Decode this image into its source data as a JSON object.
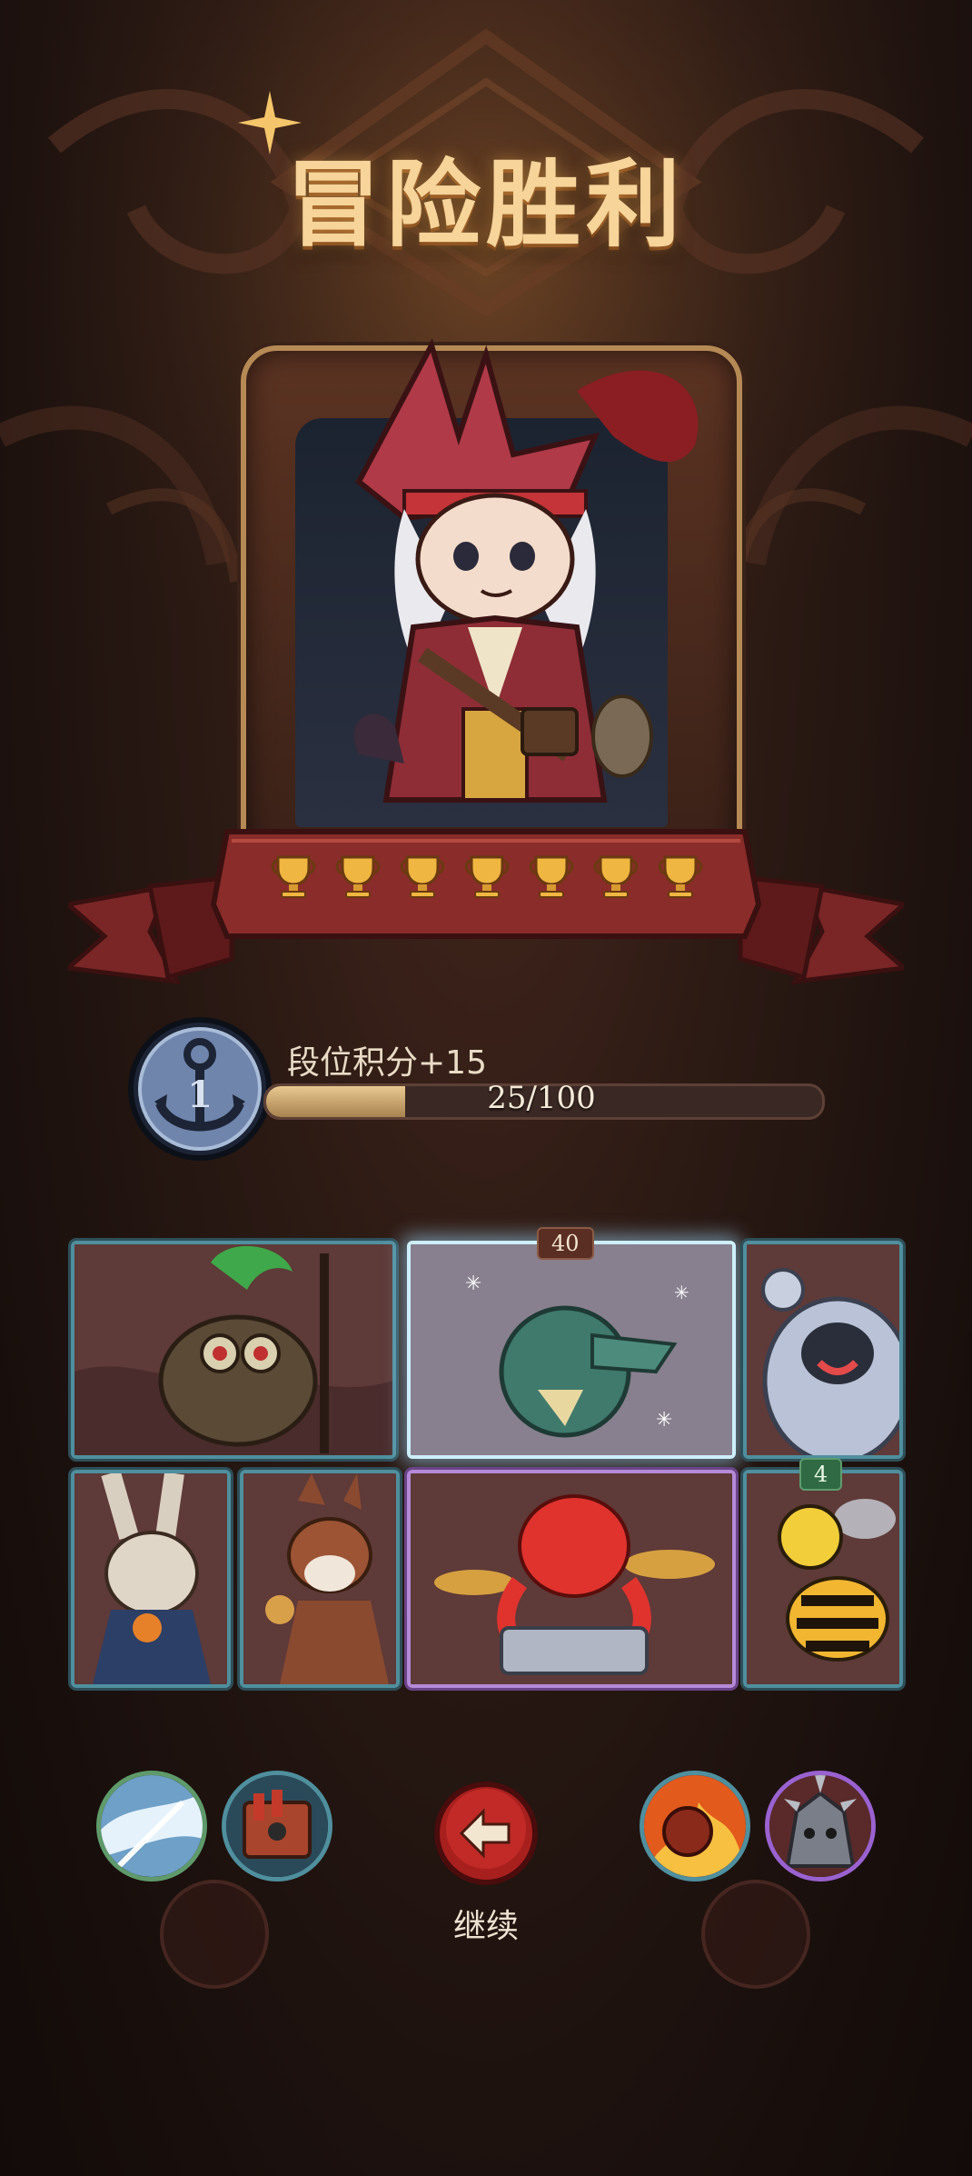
{
  "title": "冒险胜利",
  "hero": {
    "trophy_count": 7
  },
  "rank": {
    "tier_numeral": "1",
    "points_label": "段位积分+15",
    "progress_text": "25/100",
    "progress_fraction": 0.25
  },
  "team": {
    "cards": [
      {
        "name": "voodoo-owl-card",
        "frame": "teal"
      },
      {
        "name": "crocodile-card",
        "frame": "frost",
        "tag": "40"
      },
      {
        "name": "yeti-card",
        "frame": "teal"
      },
      {
        "name": "scarecrow-rabbit-card",
        "frame": "teal"
      },
      {
        "name": "squirrel-card",
        "frame": "teal"
      },
      {
        "name": "octopus-drummer-card",
        "frame": "purple"
      },
      {
        "name": "bee-card",
        "frame": "teal",
        "tag": "4"
      }
    ]
  },
  "actions": {
    "continue_label": "继续"
  },
  "colors": {
    "title_gold": "#f6d49a",
    "ribbon_red": "#8a2c2a",
    "frame_teal": "#4f8f9e",
    "frame_purple": "#b58ad8",
    "continue_red": "#a8201e"
  }
}
